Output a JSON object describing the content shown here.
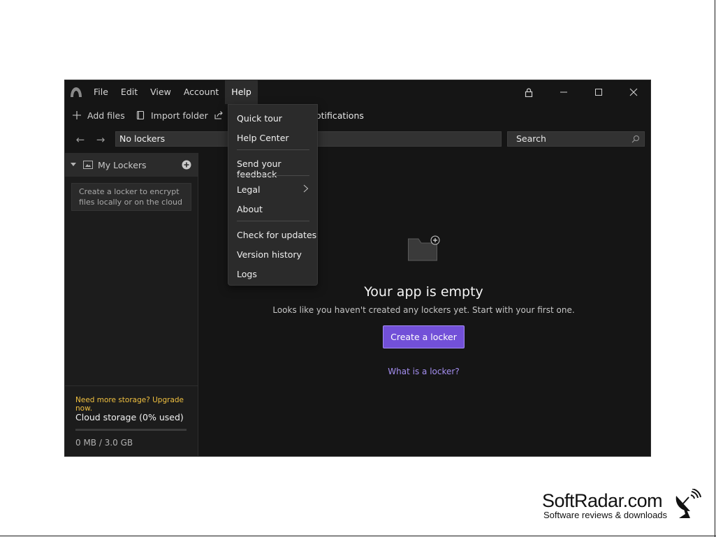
{
  "menubar": {
    "items": [
      "File",
      "Edit",
      "View",
      "Account",
      "Help"
    ],
    "active": "Help"
  },
  "toolbar": {
    "add_files": "Add files",
    "import_folder": "Import folder",
    "notifications_partial": "otifications"
  },
  "address": {
    "path": "No lockers",
    "search_placeholder": "Search"
  },
  "sidebar": {
    "section_title": "My Lockers",
    "empty_hint": "Create a locker to encrypt files locally or on the cloud",
    "upgrade_text": "Need more storage? Upgrade now.",
    "storage_title": "Cloud storage (0% used)",
    "storage_used_fraction": 0,
    "storage_size": "0 MB / 3.0 GB"
  },
  "main": {
    "empty_title": "Your app is empty",
    "empty_subtitle": "Looks like you haven't created any lockers yet. Start with your first one.",
    "create_button": "Create a locker",
    "what_link": "What is a locker?"
  },
  "help_menu": {
    "quick_tour": "Quick tour",
    "help_center": "Help Center",
    "send_feedback": "Send your feedback",
    "legal": "Legal",
    "about": "About",
    "check_updates": "Check for updates",
    "version_history": "Version history",
    "logs": "Logs"
  },
  "watermark": {
    "title": "SoftRadar.com",
    "subtitle": "Software reviews & downloads"
  },
  "colors": {
    "accent": "#7250d8",
    "link": "#a48ef0",
    "upgrade": "#f0c040",
    "background": "#151515"
  }
}
